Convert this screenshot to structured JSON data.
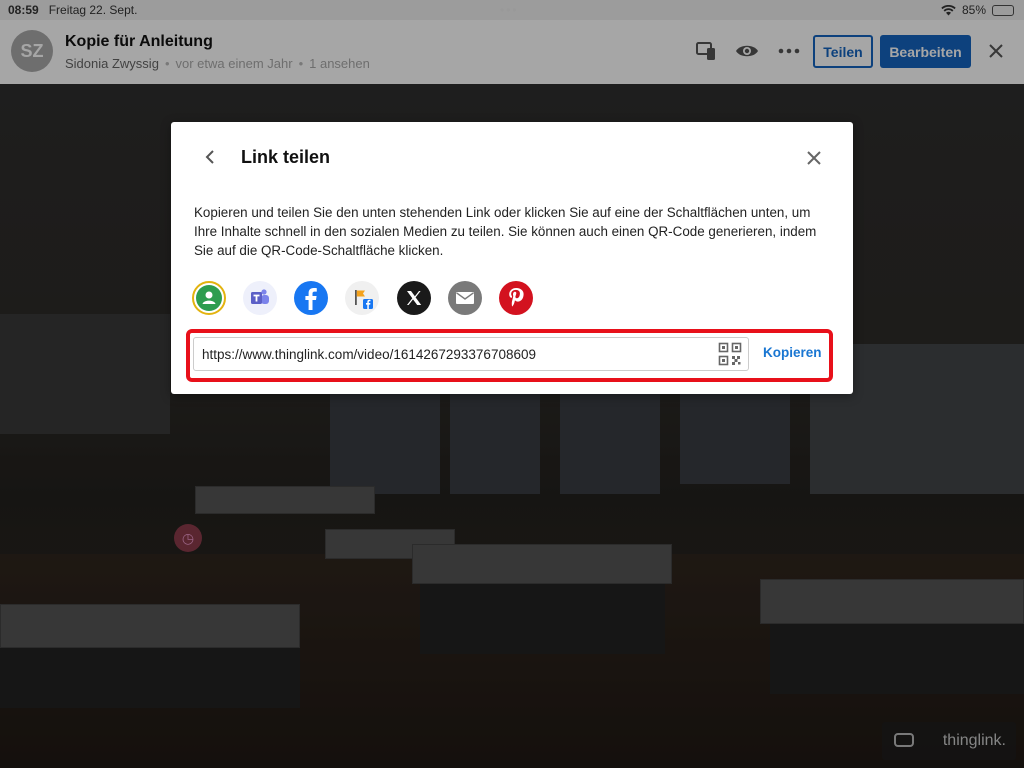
{
  "status_bar": {
    "time": "08:59",
    "date": "Freitag 22. Sept.",
    "battery": "85%",
    "battery_level": 0.85,
    "wifi_icon": "wifi-icon"
  },
  "header": {
    "avatar_initials": "SZ",
    "title": "Kopie für Anleitung",
    "author": "Sidonia Zwyssig",
    "time_ago": "vor etwa einem Jahr",
    "views": "1 ansehen",
    "share_label": "Teilen",
    "edit_label": "Bearbeiten",
    "icons": [
      "device-preview-icon",
      "eye-icon",
      "more-icon",
      "close-icon"
    ]
  },
  "modal": {
    "title": "Link teilen",
    "description": "Kopieren und teilen Sie den unten stehenden Link oder klicken Sie auf eine der Schaltflächen unten, um Ihre Inhalte schnell in den sozialen Medien zu teilen. Sie können auch einen QR-Code generieren, indem Sie auf die QR-Code-Schaltfläche klicken.",
    "share_targets": [
      {
        "name": "google-classroom-icon",
        "color": "#2e9d4f"
      },
      {
        "name": "microsoft-teams-icon",
        "color": "#5b5fc7"
      },
      {
        "name": "facebook-icon",
        "color": "#1877f2"
      },
      {
        "name": "facebook-workplace-icon",
        "color": "#f4a21d"
      },
      {
        "name": "x-twitter-icon",
        "color": "#1a1a1a"
      },
      {
        "name": "email-icon",
        "color": "#7a7a7a"
      },
      {
        "name": "pinterest-icon",
        "color": "#d3121f"
      }
    ],
    "url": "https://www.thinglink.com/video/1614267293376708609",
    "copy_label": "Kopieren"
  },
  "watermark": {
    "brand": "thinglink."
  },
  "colors": {
    "primary": "#1565c0",
    "highlight": "#e8101a"
  }
}
